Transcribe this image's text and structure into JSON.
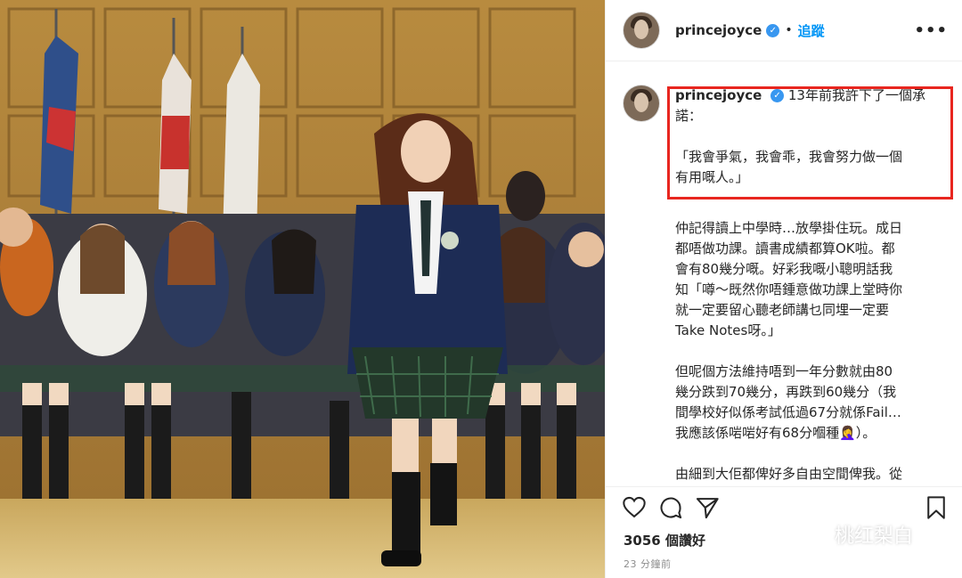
{
  "header": {
    "username": "princejoyce",
    "verified_badge": "✓",
    "separator": "•",
    "follow_label": "追蹤",
    "more_label": "•••"
  },
  "caption": {
    "username": "princejoyce",
    "intro_line1": "13年前我許下了一個承",
    "intro_line2": "諾：",
    "quote_line1": "「我會爭氣，我會乖，我會努力做一個",
    "quote_line2": "有用嘅人。」",
    "paragraphs": [
      "仲記得讀上中學時…放學掛住玩。成日\n都唔做功課。讀書成績都算OK啦。都\n會有80幾分嘅。好彩我嘅小聰明話我\n知「噂～既然你唔鍾意做功課上堂時你\n就一定要留心聽老師講乜同埋一定要\nTake Notes呀。」",
      "但呢個方法維持唔到一年分數就由80\n幾分跌到70幾分，再跌到60幾分（我\n間學校好似係考試低過67分就係Fail…\n我應該係啱啱好有68分嗰種🤦‍♀️）。",
      "由細到大佢都俾好多自由空間俾我。從\n來唔讀書方面都好信任我會乖會聽著自"
    ],
    "highlight_color": "#e8261f"
  },
  "actions": {
    "icons": [
      "heart-icon",
      "comment-icon",
      "share-icon",
      "bookmark-icon"
    ],
    "likes": "3056 個讚好",
    "time": "23 分鐘前"
  },
  "watermark": {
    "text": "桃红梨白"
  },
  "colors": {
    "link_blue": "#0095f6",
    "verified_blue": "#3897f0",
    "muted": "#8e8e8e"
  }
}
